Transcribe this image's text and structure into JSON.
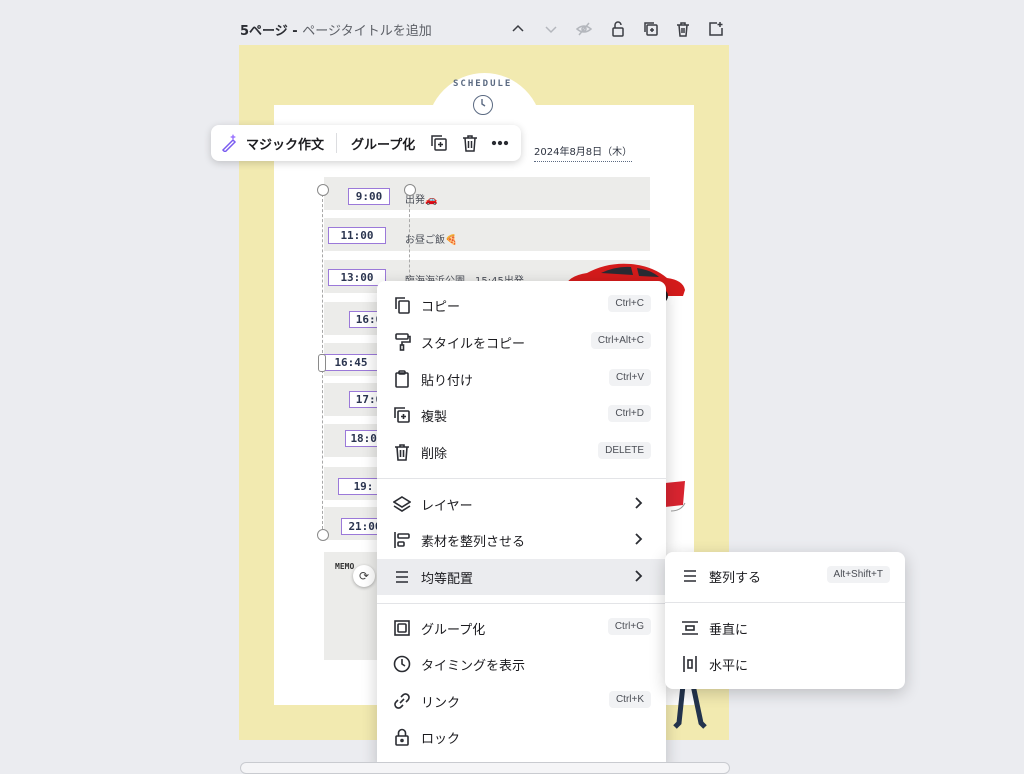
{
  "header": {
    "page_label": "5ページ - ",
    "page_title_placeholder": "ページタイトルを追加"
  },
  "header_tools": [
    {
      "name": "move-up-icon"
    },
    {
      "name": "move-down-icon"
    },
    {
      "name": "hide-page-icon"
    },
    {
      "name": "lock-page-icon"
    },
    {
      "name": "duplicate-page-icon"
    },
    {
      "name": "delete-page-icon"
    },
    {
      "name": "add-page-icon"
    }
  ],
  "design": {
    "schedule_word": "SCHEDULE",
    "date": "2024年8月8日（木）",
    "memo_label": "MEMO",
    "rows": [
      {
        "time": "9:00",
        "event": "出発🚗"
      },
      {
        "time": "11:00",
        "event": "お昼ご飯🍕"
      },
      {
        "time": "13:00",
        "event": "臨海海浜公園　15:45出発"
      },
      {
        "time": "16:0",
        "event": ""
      },
      {
        "time": "16:45",
        "event": ""
      },
      {
        "time": "17:0",
        "event": ""
      },
      {
        "time": "18:00",
        "event": ""
      },
      {
        "time": "19:",
        "event": ""
      },
      {
        "time": "21:00",
        "event": ""
      }
    ]
  },
  "floating_toolbar": {
    "magic_write": "マジック作文",
    "group": "グループ化"
  },
  "context_menu": {
    "items": [
      {
        "label": "コピー",
        "shortcut": "Ctrl+C",
        "icon": "copy-icon"
      },
      {
        "label": "スタイルをコピー",
        "shortcut": "Ctrl+Alt+C",
        "icon": "paint-roller-icon"
      },
      {
        "label": "貼り付け",
        "shortcut": "Ctrl+V",
        "icon": "clipboard-icon"
      },
      {
        "label": "複製",
        "shortcut": "Ctrl+D",
        "icon": "duplicate-icon"
      },
      {
        "label": "削除",
        "shortcut": "DELETE",
        "icon": "trash-icon"
      },
      {
        "label": "レイヤー",
        "icon": "layers-icon"
      },
      {
        "label": "素材を整列させる",
        "icon": "align-left-icon"
      },
      {
        "label": "均等配置",
        "icon": "distribute-icon"
      },
      {
        "label": "グループ化",
        "shortcut": "Ctrl+G",
        "icon": "group-icon"
      },
      {
        "label": "タイミングを表示",
        "icon": "clock-icon"
      },
      {
        "label": "リンク",
        "shortcut": "Ctrl+K",
        "icon": "link-icon"
      },
      {
        "label": "ロック",
        "icon": "lock-icon"
      }
    ]
  },
  "submenu": {
    "items": [
      {
        "label": "整列する",
        "shortcut": "Alt+Shift+T",
        "icon": "tidy-up-icon"
      },
      {
        "label": "垂直に",
        "icon": "distribute-vertical-icon"
      },
      {
        "label": "水平に",
        "icon": "distribute-horizontal-icon"
      }
    ]
  }
}
